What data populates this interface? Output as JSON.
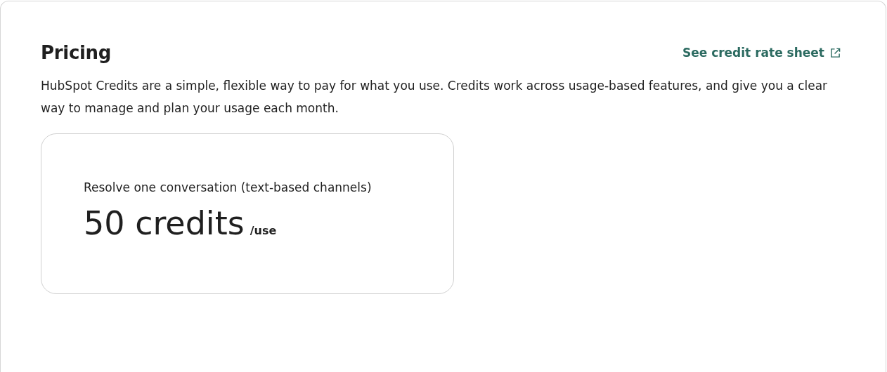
{
  "section": {
    "title": "Pricing",
    "link": "See credit rate sheet",
    "description": "HubSpot Credits are a simple, flexible way to pay for what you use. Credits work across usage-based features, and give you a clear way to manage and plan your usage each month."
  },
  "price_cards": [
    {
      "label": "Resolve one conversation (text-based channels)",
      "amount": "50 credits",
      "unit": "/use"
    }
  ]
}
